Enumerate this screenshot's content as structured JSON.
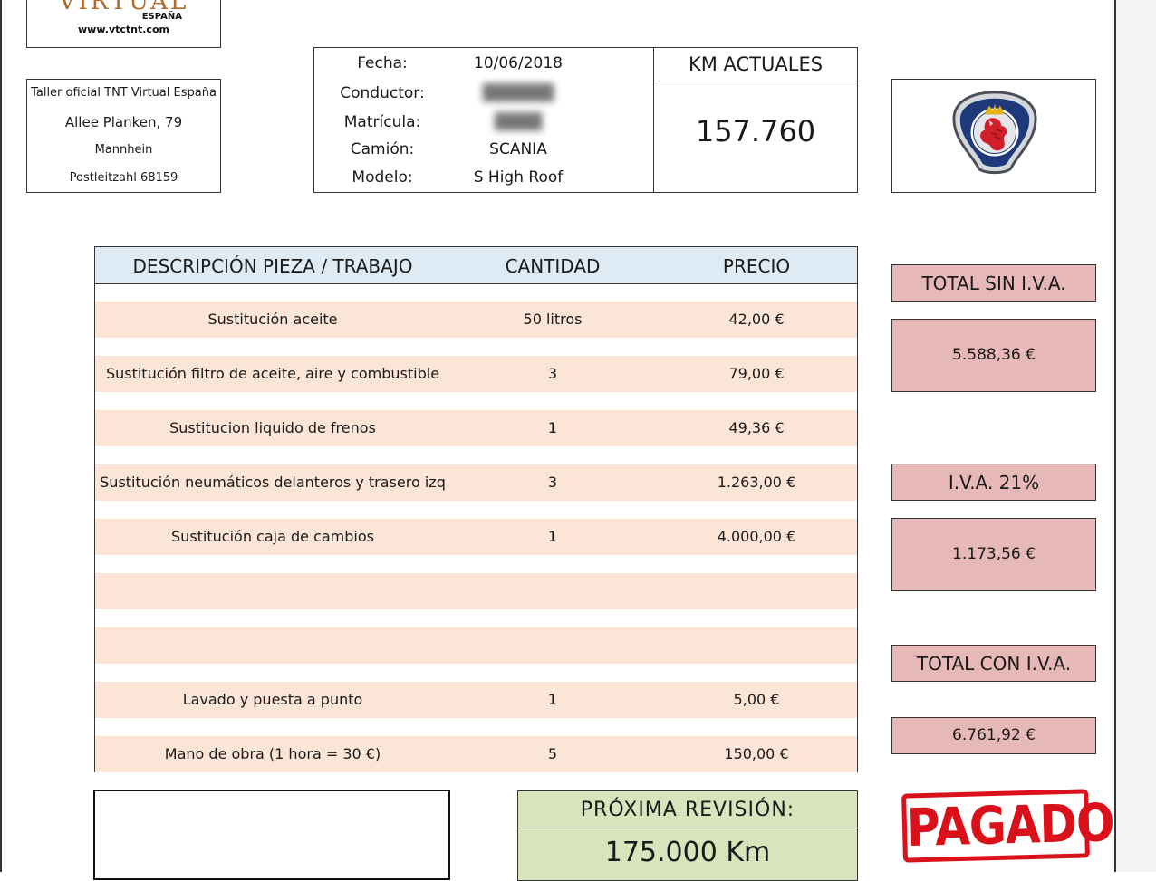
{
  "logo": {
    "word": "VIRTUAL",
    "sub": "ESPAÑA",
    "url": "www.vtctnt.com"
  },
  "workshop": {
    "name": "Taller oficial TNT Virtual España",
    "street": "Allee Planken, 79",
    "city": "Mannhein",
    "postal": "Postleitzahl 68159"
  },
  "vehicle": {
    "fecha_label": "Fecha:",
    "fecha": "10/06/2018",
    "conductor_label": "Conductor:",
    "conductor": "██████",
    "matricula_label": "Matrícula:",
    "matricula": "████",
    "camion_label": "Camión:",
    "camion": "SCANIA",
    "modelo_label": "Modelo:",
    "modelo": "S High Roof"
  },
  "km": {
    "title": "KM ACTUALES",
    "value": "157.760"
  },
  "brand": {
    "icon": "scania-griffin-icon"
  },
  "table": {
    "headers": {
      "desc": "DESCRIPCIÓN PIEZA /  TRABAJO",
      "qty": "CANTIDAD",
      "price": "PRECIO"
    },
    "rows": [
      {
        "desc": "Sustitución aceite",
        "qty": "50 litros",
        "price": "42,00 €"
      },
      {
        "desc": "Sustitución filtro de aceite, aire y combustible",
        "qty": "3",
        "price": "79,00 €"
      },
      {
        "desc": "Sustitucion liquido de frenos",
        "qty": "1",
        "price": "49,36 €"
      },
      {
        "desc": "Sustitución neumáticos delanteros  y trasero izq",
        "qty": "3",
        "price": "1.263,00 €"
      },
      {
        "desc": "Sustitución caja de cambios",
        "qty": "1",
        "price": "4.000,00 €"
      },
      {
        "desc": "",
        "qty": "",
        "price": ""
      },
      {
        "desc": "",
        "qty": "",
        "price": ""
      },
      {
        "desc": "Lavado y puesta a punto",
        "qty": "1",
        "price": "5,00 €"
      },
      {
        "desc": "Mano de obra (1 hora = 30 €)",
        "qty": "5",
        "price": "150,00 €"
      }
    ]
  },
  "totals": {
    "sin_iva_label": "TOTAL SIN I.V.A.",
    "sin_iva": "5.588,36 €",
    "iva_label": "I.V.A. 21%",
    "iva": "1.173,56 €",
    "con_iva_label": "TOTAL CON I.V.A.",
    "con_iva": "6.761,92 €"
  },
  "revision": {
    "title": "PRÓXIMA REVISIÓN:",
    "value": "175.000 Km"
  },
  "stamp": {
    "text": "PAGADO"
  },
  "colors": {
    "header_blue": "#deebf5",
    "row_peach": "#fbe5d6",
    "total_pink": "#e6b8b7",
    "revision_green": "#d8e4bc",
    "stamp_red": "#d9111b"
  }
}
